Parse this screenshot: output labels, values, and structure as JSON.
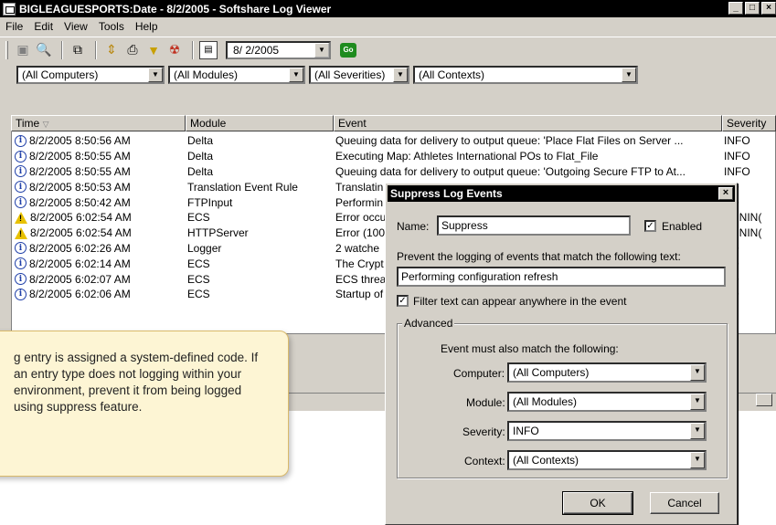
{
  "window": {
    "title": "BIGLEAGUESPORTS:Date - 8/2/2005 - Softshare Log Viewer",
    "min_glyph": "_",
    "max_glyph": "□",
    "close_glyph": "×"
  },
  "menu": [
    "File",
    "Edit",
    "View",
    "Tools",
    "Help"
  ],
  "toolbar": {
    "date": "8/ 2/2005",
    "go_label": "Go"
  },
  "filters": {
    "computers": "(All Computers)",
    "modules": "(All Modules)",
    "severities": "(All Severities)",
    "contexts": "(All Contexts)"
  },
  "table": {
    "headers": [
      "Time",
      "Module",
      "Event",
      "Severity"
    ],
    "rows": [
      {
        "type": "info",
        "time": "8/2/2005 8:50:56 AM",
        "module": "Delta",
        "event": "Queuing data for delivery to output queue: 'Place Flat Files on Server ...",
        "severity": "INFO"
      },
      {
        "type": "info",
        "time": "8/2/2005 8:50:55 AM",
        "module": "Delta",
        "event": "Executing Map: Athletes International POs to Flat_File",
        "severity": "INFO"
      },
      {
        "type": "info",
        "time": "8/2/2005 8:50:55 AM",
        "module": "Delta",
        "event": "Queuing data for delivery to output queue: 'Outgoing Secure FTP to At...",
        "severity": "INFO"
      },
      {
        "type": "info",
        "time": "8/2/2005 8:50:53 AM",
        "module": "Translation Event Rule",
        "event": "Translatin",
        "severity": "FO"
      },
      {
        "type": "info",
        "time": "8/2/2005 8:50:42 AM",
        "module": "FTPInput",
        "event": "Performin",
        "severity": "FO"
      },
      {
        "type": "warn",
        "time": "8/2/2005 6:02:54 AM",
        "module": "ECS",
        "event": "Error occu",
        "severity": "ARNIN("
      },
      {
        "type": "warn",
        "time": "8/2/2005 6:02:54 AM",
        "module": "HTTPServer",
        "event": "Error (100",
        "severity": "ARNIN("
      },
      {
        "type": "info",
        "time": "8/2/2005 6:02:26 AM",
        "module": "Logger",
        "event": "2 watche",
        "severity": "FO"
      },
      {
        "type": "info",
        "time": "8/2/2005 6:02:14 AM",
        "module": "ECS",
        "event": "The Crypt",
        "severity": "FO"
      },
      {
        "type": "info",
        "time": "8/2/2005 6:02:07 AM",
        "module": "ECS",
        "event": "ECS threa",
        "severity": "FO"
      },
      {
        "type": "info",
        "time": "8/2/2005 6:02:06 AM",
        "module": "ECS",
        "event": "Startup of",
        "severity": "FO"
      }
    ]
  },
  "callout": {
    "text": "g entry is assigned a system-defined code. If an entry type does not logging within your environment, prevent it from being logged using suppress feature."
  },
  "dialog": {
    "title": "Suppress Log Events",
    "name_label": "Name:",
    "name_value": "Suppress",
    "enabled_label": "Enabled",
    "enabled_checked": true,
    "prevent_label": "Prevent the logging of events that match the following text:",
    "prevent_value": "Performing configuration refresh",
    "anywhere_label": "Filter text can appear anywhere in the event",
    "anywhere_checked": true,
    "advanced_label": "Advanced",
    "must_match_label": "Event must also match the following:",
    "computer_label": "Computer:",
    "computer_value": "(All Computers)",
    "module_label": "Module:",
    "module_value": "(All Modules)",
    "severity_label": "Severity:",
    "severity_value": "INFO",
    "context_label": "Context:",
    "context_value": "(All Contexts)",
    "ok_label": "OK",
    "cancel_label": "Cancel",
    "check_glyph": "✓"
  }
}
